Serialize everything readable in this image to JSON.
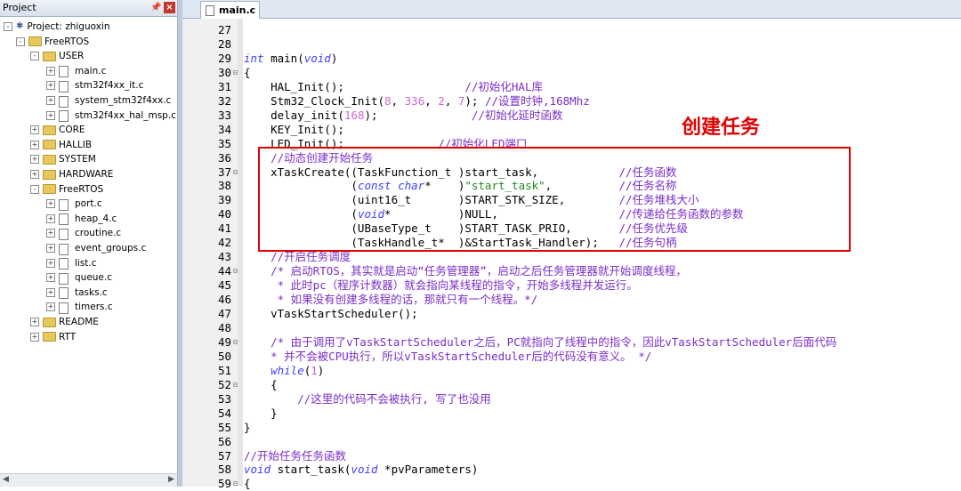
{
  "project": {
    "title": "Project",
    "root_label": "Project: zhiguoxin",
    "tree": [
      {
        "label": "FreeRTOS",
        "type": "target",
        "expand": "-"
      },
      {
        "label": "USER",
        "type": "folder",
        "expand": "-"
      },
      {
        "label": "main.c",
        "type": "file",
        "expand": "+"
      },
      {
        "label": "stm32f4xx_it.c",
        "type": "file",
        "expand": "+"
      },
      {
        "label": "system_stm32f4xx.c",
        "type": "file",
        "expand": "+"
      },
      {
        "label": "stm32f4xx_hal_msp.c",
        "type": "file",
        "expand": "+"
      },
      {
        "label": "CORE",
        "type": "folder",
        "expand": "+"
      },
      {
        "label": "HALLIB",
        "type": "folder",
        "expand": "+"
      },
      {
        "label": "SYSTEM",
        "type": "folder",
        "expand": "+"
      },
      {
        "label": "HARDWARE",
        "type": "folder",
        "expand": "+"
      },
      {
        "label": "FreeRTOS",
        "type": "folder",
        "expand": "-"
      },
      {
        "label": "port.c",
        "type": "file",
        "expand": "+"
      },
      {
        "label": "heap_4.c",
        "type": "file",
        "expand": "+"
      },
      {
        "label": "croutine.c",
        "type": "file",
        "expand": "+"
      },
      {
        "label": "event_groups.c",
        "type": "file",
        "expand": "+"
      },
      {
        "label": "list.c",
        "type": "file",
        "expand": "+"
      },
      {
        "label": "queue.c",
        "type": "file",
        "expand": "+"
      },
      {
        "label": "tasks.c",
        "type": "file",
        "expand": "+"
      },
      {
        "label": "timers.c",
        "type": "file",
        "expand": "+"
      },
      {
        "label": "README",
        "type": "folder",
        "expand": "+"
      },
      {
        "label": "RTT",
        "type": "folder",
        "expand": "+"
      }
    ]
  },
  "editor": {
    "tab_label": "main.c",
    "annotation": "创建任务",
    "lines": [
      {
        "n": "27",
        "fold": "",
        "seg": []
      },
      {
        "n": "28",
        "fold": "",
        "seg": []
      },
      {
        "n": "29",
        "fold": "",
        "seg": [
          [
            "kw",
            "int"
          ],
          [
            "def",
            " main("
          ],
          [
            "kw",
            "void"
          ],
          [
            "def",
            ")"
          ]
        ]
      },
      {
        "n": "30",
        "fold": "⊟",
        "seg": [
          [
            "def",
            "{"
          ]
        ]
      },
      {
        "n": "31",
        "fold": "",
        "seg": [
          [
            "def",
            "    HAL_Init();                  "
          ],
          [
            "cm",
            "//初始化HAL库"
          ]
        ]
      },
      {
        "n": "32",
        "fold": "",
        "seg": [
          [
            "def",
            "    Stm32_Clock_Init("
          ],
          [
            "num",
            "8"
          ],
          [
            "def",
            ", "
          ],
          [
            "num",
            "336"
          ],
          [
            "def",
            ", "
          ],
          [
            "num",
            "2"
          ],
          [
            "def",
            ", "
          ],
          [
            "num",
            "7"
          ],
          [
            "def",
            "); "
          ],
          [
            "cm",
            "//设置时钟,168Mhz"
          ]
        ]
      },
      {
        "n": "33",
        "fold": "",
        "seg": [
          [
            "def",
            "    delay_init("
          ],
          [
            "num",
            "168"
          ],
          [
            "def",
            ");              "
          ],
          [
            "cm",
            "//初始化延时函数"
          ]
        ]
      },
      {
        "n": "34",
        "fold": "",
        "seg": [
          [
            "def",
            "    KEY_Init();"
          ]
        ]
      },
      {
        "n": "35",
        "fold": "",
        "seg": [
          [
            "def",
            "    LED_Init();              "
          ],
          [
            "cm",
            "//初始化LED端口"
          ]
        ]
      },
      {
        "n": "36",
        "fold": "",
        "seg": [
          [
            "cm",
            "    //动态创建开始任务"
          ]
        ]
      },
      {
        "n": "37",
        "fold": "⊟",
        "seg": [
          [
            "def",
            "    xTaskCreate((TaskFunction_t )start_task,            "
          ],
          [
            "cm",
            "//任务函数"
          ]
        ]
      },
      {
        "n": "38",
        "fold": "",
        "seg": [
          [
            "def",
            "                ("
          ],
          [
            "kw",
            "const char"
          ],
          [
            "def",
            "*    )"
          ],
          [
            "str",
            "\"start_task\""
          ],
          [
            "def",
            ",          "
          ],
          [
            "cm",
            "//任务名称"
          ]
        ]
      },
      {
        "n": "39",
        "fold": "",
        "seg": [
          [
            "def",
            "                (uint16_t       )START_STK_SIZE,        "
          ],
          [
            "cm",
            "//任务堆栈大小"
          ]
        ]
      },
      {
        "n": "40",
        "fold": "",
        "seg": [
          [
            "def",
            "                ("
          ],
          [
            "kw",
            "void"
          ],
          [
            "def",
            "*          )NULL,                  "
          ],
          [
            "cm",
            "//传递给任务函数的参数"
          ]
        ]
      },
      {
        "n": "41",
        "fold": "",
        "seg": [
          [
            "def",
            "                (UBaseType_t    )START_TASK_PRIO,       "
          ],
          [
            "cm",
            "//任务优先级"
          ]
        ]
      },
      {
        "n": "42",
        "fold": "",
        "seg": [
          [
            "def",
            "                (TaskHandle_t*  )&StartTask_Handler);   "
          ],
          [
            "cm",
            "//任务句柄"
          ]
        ]
      },
      {
        "n": "43",
        "fold": "",
        "seg": [
          [
            "cm",
            "    //开启任务调度"
          ]
        ]
      },
      {
        "n": "44",
        "fold": "⊟",
        "seg": [
          [
            "cm",
            "    /* 启动RTOS，其实就是启动“任务管理器”，启动之后任务管理器就开始调度线程，"
          ]
        ]
      },
      {
        "n": "45",
        "fold": "",
        "seg": [
          [
            "cm",
            "     * 此时pc（程序计数器）就会指向某线程的指令，开始多线程并发运行。"
          ]
        ]
      },
      {
        "n": "46",
        "fold": "",
        "seg": [
          [
            "cm",
            "     * 如果没有创建多线程的话，那就只有一个线程。*/"
          ]
        ]
      },
      {
        "n": "47",
        "fold": "",
        "seg": [
          [
            "def",
            "    vTaskStartScheduler();"
          ]
        ]
      },
      {
        "n": "48",
        "fold": "",
        "seg": []
      },
      {
        "n": "49",
        "fold": "⊟",
        "seg": [
          [
            "cm",
            "    /* 由于调用了vTaskStartScheduler之后，PC就指向了线程中的指令，因此vTaskStartScheduler后面代码"
          ]
        ]
      },
      {
        "n": "50",
        "fold": "",
        "seg": [
          [
            "cm",
            "    * 并不会被CPU执行，所以vTaskStartScheduler后的代码没有意义。 */"
          ]
        ]
      },
      {
        "n": "51",
        "fold": "",
        "seg": [
          [
            "kw",
            "    while"
          ],
          [
            "def",
            "("
          ],
          [
            "num",
            "1"
          ],
          [
            "def",
            ")"
          ]
        ]
      },
      {
        "n": "52",
        "fold": "⊟",
        "seg": [
          [
            "def",
            "    {"
          ]
        ]
      },
      {
        "n": "53",
        "fold": "",
        "seg": [
          [
            "cm",
            "        //这里的代码不会被执行, 写了也没用"
          ]
        ]
      },
      {
        "n": "54",
        "fold": "",
        "seg": [
          [
            "def",
            "    }"
          ]
        ]
      },
      {
        "n": "55",
        "fold": "",
        "seg": [
          [
            "def",
            "}"
          ]
        ]
      },
      {
        "n": "56",
        "fold": "",
        "seg": []
      },
      {
        "n": "57",
        "fold": "",
        "seg": [
          [
            "cm",
            "//开始任务任务函数"
          ]
        ]
      },
      {
        "n": "58",
        "fold": "",
        "seg": [
          [
            "kw",
            "void"
          ],
          [
            "def",
            " start_task("
          ],
          [
            "kw",
            "void"
          ],
          [
            "def",
            " *pvParameters)"
          ]
        ]
      },
      {
        "n": "59",
        "fold": "⊟",
        "seg": [
          [
            "def",
            "{"
          ]
        ]
      }
    ]
  }
}
